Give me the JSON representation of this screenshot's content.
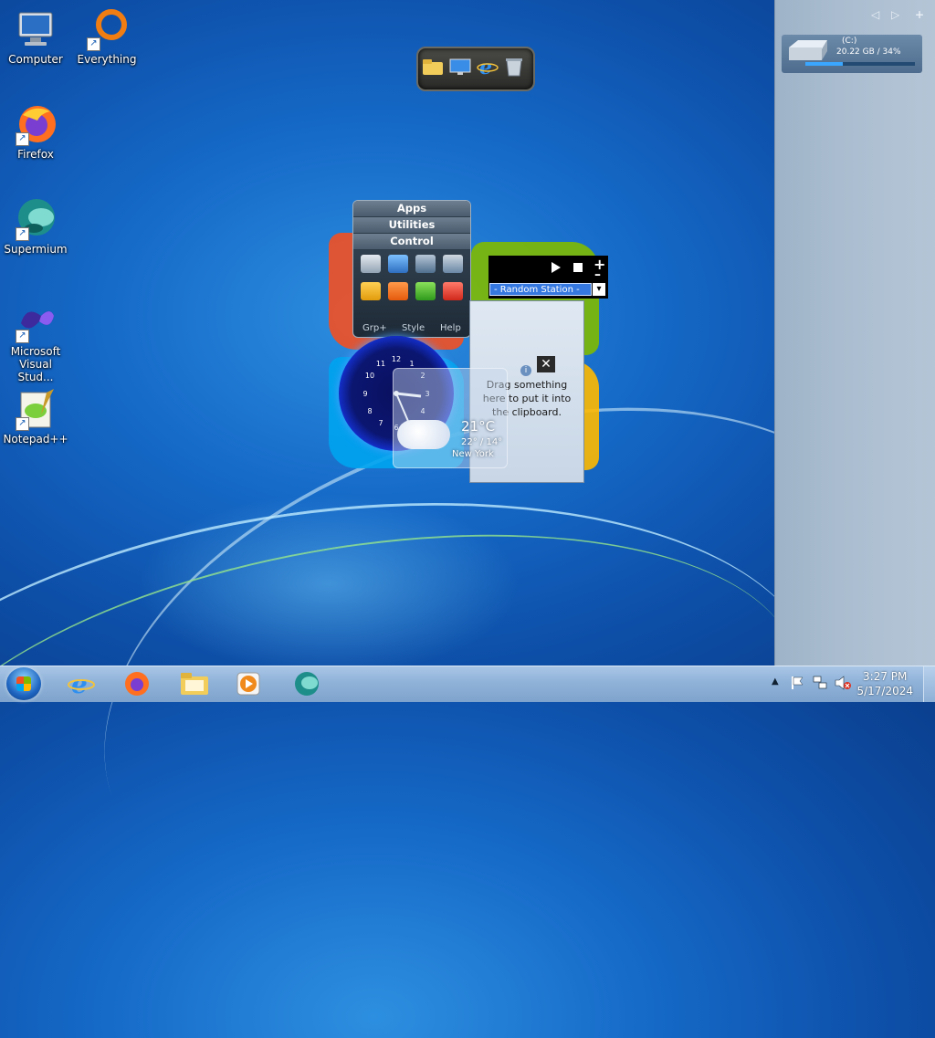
{
  "desktop_icons": [
    {
      "label": "Computer",
      "icon": "computer-icon"
    },
    {
      "label": "Everything",
      "icon": "everything-search-icon"
    },
    {
      "label": "Firefox",
      "icon": "firefox-icon"
    },
    {
      "label": "Supermium",
      "icon": "supermium-icon"
    },
    {
      "label": "Microsoft Visual Stud...",
      "icon": "visual-studio-icon"
    },
    {
      "label": "Notepad++",
      "icon": "notepadpp-icon"
    }
  ],
  "sidebar": {
    "drive": {
      "letter": "(C:)",
      "info": "20.22 GB / 34%",
      "usage_percent": 34
    }
  },
  "app_launcher_gadget": {
    "icons": [
      "folder-icon",
      "monitor-icon",
      "internet-explorer-icon",
      "recycle-bin-icon"
    ]
  },
  "menu_gadget": {
    "rows": [
      "Apps",
      "Utilities",
      "Control"
    ],
    "footer": [
      "Grp+",
      "Style",
      "Help"
    ]
  },
  "radio_gadget": {
    "station": "- Random Station -"
  },
  "clipboard_gadget": {
    "text": "Drag something here to put it into the clipboard."
  },
  "weather_gadget": {
    "temp": "21°C",
    "range": "22° / 14°",
    "city": "New York"
  },
  "clock_gadget": {
    "time": "3:27"
  },
  "taskbar": {
    "pinned": [
      "internet-explorer-icon",
      "firefox-icon",
      "file-explorer-icon",
      "media-player-icon",
      "supermium-icon"
    ],
    "clock_time": "3:27 PM",
    "clock_date": "5/17/2024"
  }
}
